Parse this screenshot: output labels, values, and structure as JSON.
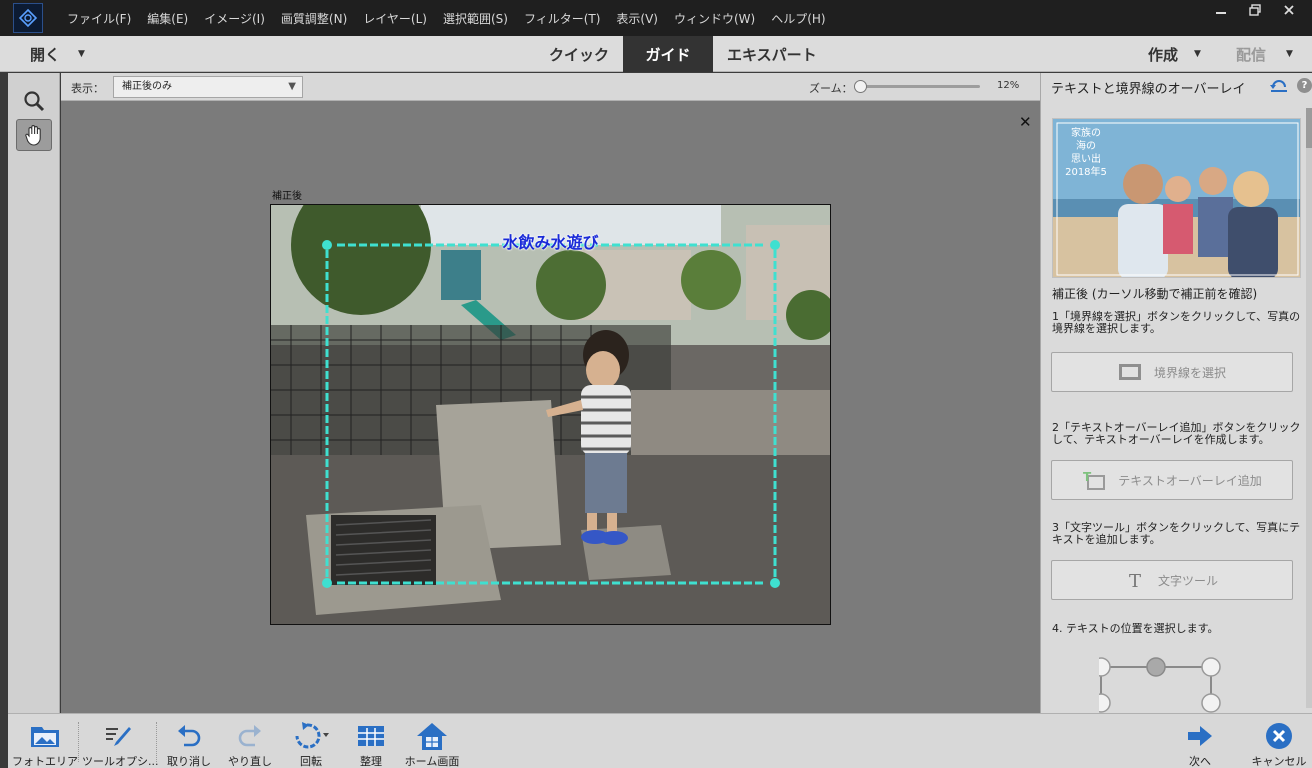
{
  "menubar": {
    "items": [
      "ファイル(F)",
      "編集(E)",
      "イメージ(I)",
      "画質調整(N)",
      "レイヤー(L)",
      "選択範囲(S)",
      "フィルター(T)",
      "表示(V)",
      "ウィンドウ(W)",
      "ヘルプ(H)"
    ],
    "window_buttons": [
      "minimize-icon",
      "restore-icon",
      "close-icon"
    ]
  },
  "modebar": {
    "open_label": "開く",
    "tabs": [
      {
        "label": "クイック",
        "active": false
      },
      {
        "label": "ガイド",
        "active": true
      },
      {
        "label": "エキスパート",
        "active": false
      }
    ],
    "create_label": "作成",
    "share_label": "配信"
  },
  "tools": [
    {
      "name": "zoom-tool",
      "icon": "magnifier-icon"
    },
    {
      "name": "hand-tool",
      "icon": "hand-icon",
      "selected": true
    }
  ],
  "options": {
    "view_label": "表示：",
    "view_value": "補正後のみ",
    "zoom_label": "ズーム：",
    "zoom_value": "12%"
  },
  "canvas": {
    "photo_label": "補正後",
    "overlay_text": "水飲み水遊び",
    "frame_color": "#3fe0d0",
    "overlay_text_color": "#1a2bd8"
  },
  "panel": {
    "title": "テキストと境界線のオーバーレイ",
    "help": "?",
    "thumb_text": [
      "家族の",
      "海の",
      "思い出",
      "2018年5"
    ],
    "caption": "補正後 (カーソル移動で補正前を確認)",
    "steps": [
      {
        "text": "1「境界線を選択」ボタンをクリックして、写真の境界線を選択します。",
        "button": "境界線を選択"
      },
      {
        "text": "2「テキストオーバーレイ追加」ボタンをクリックして、テキストオーバーレイを作成します。",
        "button": "テキストオーバーレイ追加"
      },
      {
        "text": "3「文字ツール」ボタンをクリックして、写真にテキストを追加します。",
        "button": "文字ツール"
      },
      {
        "text": "4. テキストの位置を選択します。"
      }
    ]
  },
  "bottombar": {
    "buttons": [
      "フォトエリア",
      "ツールオプシ...",
      "取り消し",
      "やり直し",
      "回転",
      "整理",
      "ホーム画面"
    ],
    "next_label": "次へ",
    "cancel_label": "キャンセル"
  },
  "colors": {
    "menubar_bg": "#1f1f1f",
    "active_tab_bg": "#333333",
    "accent_blue": "#2a6fc4"
  }
}
